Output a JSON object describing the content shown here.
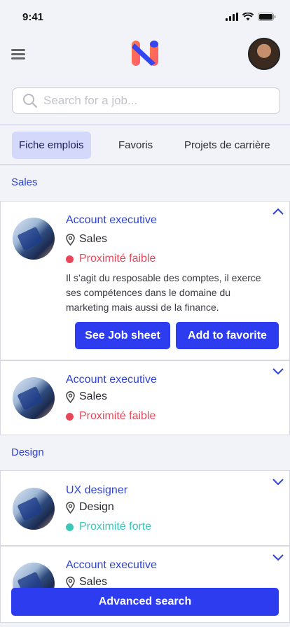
{
  "status": {
    "time": "9:41"
  },
  "search": {
    "placeholder": "Search for a job..."
  },
  "tabs": [
    {
      "label": "Fiche emplois",
      "active": true
    },
    {
      "label": "Favoris",
      "active": false
    },
    {
      "label": "Projets de carrière",
      "active": false
    }
  ],
  "sections": [
    {
      "title": "Sales",
      "jobs": [
        {
          "title": "Account executive",
          "location": "Sales",
          "proximity": "Proximité faible",
          "proximity_color": "#e8475a",
          "expanded": true,
          "description": "Il s’agit du resposable des comptes, il exerce ses compétences dans le domaine du marketing mais aussi de la finance.",
          "primary_button": "See Job sheet",
          "secondary_button": "Add to favorite"
        },
        {
          "title": "Account executive",
          "location": "Sales",
          "proximity": "Proximité faible",
          "proximity_color": "#e8475a",
          "expanded": false
        }
      ]
    },
    {
      "title": "Design",
      "jobs": [
        {
          "title": "UX designer",
          "location": "Design",
          "proximity": "Proximité forte",
          "proximity_color": "#3cc7b8",
          "expanded": false
        },
        {
          "title": "Account executive",
          "location": "Sales",
          "expanded": false
        }
      ]
    }
  ],
  "advanced_search_label": "Advanced search",
  "colors": {
    "accent": "#2e3cf0",
    "link": "#2f43d6",
    "active_tab": "#d4d8fb"
  }
}
